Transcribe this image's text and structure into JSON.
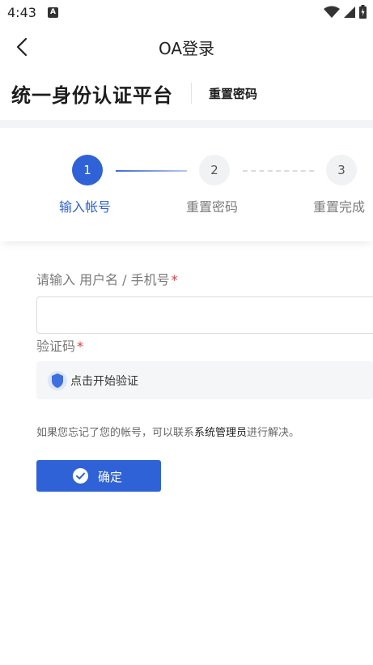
{
  "status_bar": {
    "time": "4:43",
    "badge_letter": "A",
    "icons": [
      "wifi-icon",
      "signal-icon",
      "battery-icon"
    ]
  },
  "nav": {
    "title": "OA登录",
    "back_icon": "chevron-left-icon"
  },
  "header": {
    "platform_title": "统一身份认证平台",
    "reset_link": "重置密码"
  },
  "steps": [
    {
      "number": "1",
      "label": "输入帐号",
      "state": "active"
    },
    {
      "number": "2",
      "label": "重置密码",
      "state": "inactive"
    },
    {
      "number": "3",
      "label": "重置完成",
      "state": "inactive"
    }
  ],
  "form": {
    "username_label": "请输入 用户名 / 手机号",
    "username_value": "",
    "captcha_label": "验证码",
    "required_mark": "*",
    "verify_text": "点击开始验证",
    "help_prefix": "如果您忘记了您的帐号，可以联系",
    "help_link": "系统管理员",
    "help_suffix": "进行解决。",
    "confirm_label": "确定"
  },
  "colors": {
    "primary": "#2f62d6",
    "required": "#e23a3a",
    "input_border": "#dcdcdc",
    "verify_bg": "#f5f6f8"
  }
}
